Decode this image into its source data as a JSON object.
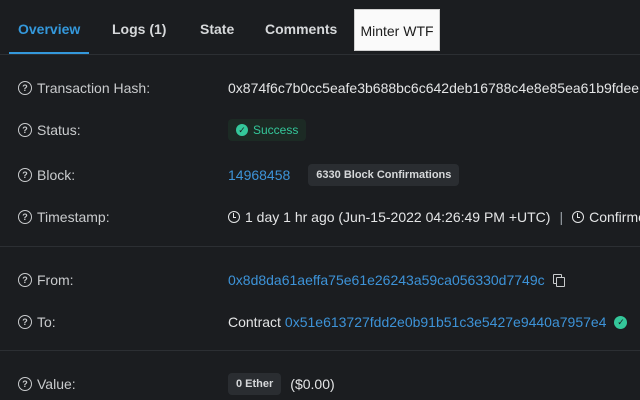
{
  "tabs": {
    "overview": "Overview",
    "logs": "Logs (1)",
    "state": "State",
    "comments": "Comments",
    "custom": "Minter WTF"
  },
  "rows": {
    "hash": {
      "label": "Transaction Hash:",
      "value": "0x874f6c7b0cc5eafe3b688bc6c642deb16788c4e8e85ea61b9fdee"
    },
    "status": {
      "label": "Status:",
      "value": "Success"
    },
    "block": {
      "label": "Block:",
      "number": "14968458",
      "confirmations": "6330 Block Confirmations"
    },
    "timestamp": {
      "label": "Timestamp:",
      "value": "1 day 1 hr ago (Jun-15-2022 04:26:49 PM +UTC)",
      "separator": "|",
      "confirmed": "Confirme"
    },
    "from": {
      "label": "From:",
      "address": "0x8d8da61aeffa75e61e26243a59ca056330d7749c"
    },
    "to": {
      "label": "To:",
      "prefix": "Contract",
      "address": "0x51e613727fdd2e0b91b51c3e5427e9440a7957e4"
    },
    "value": {
      "label": "Value:",
      "amount": "0 Ether",
      "usd": "($0.00)"
    }
  },
  "colors": {
    "background": "#1b1d20",
    "accent": "#3498db",
    "link": "#3d93d8",
    "success": "#34c79a"
  },
  "icons": {
    "help": "question-circle-icon",
    "success": "check-circle-icon",
    "clock": "clock-icon",
    "copy": "copy-icon",
    "verified": "verified-check-icon"
  }
}
